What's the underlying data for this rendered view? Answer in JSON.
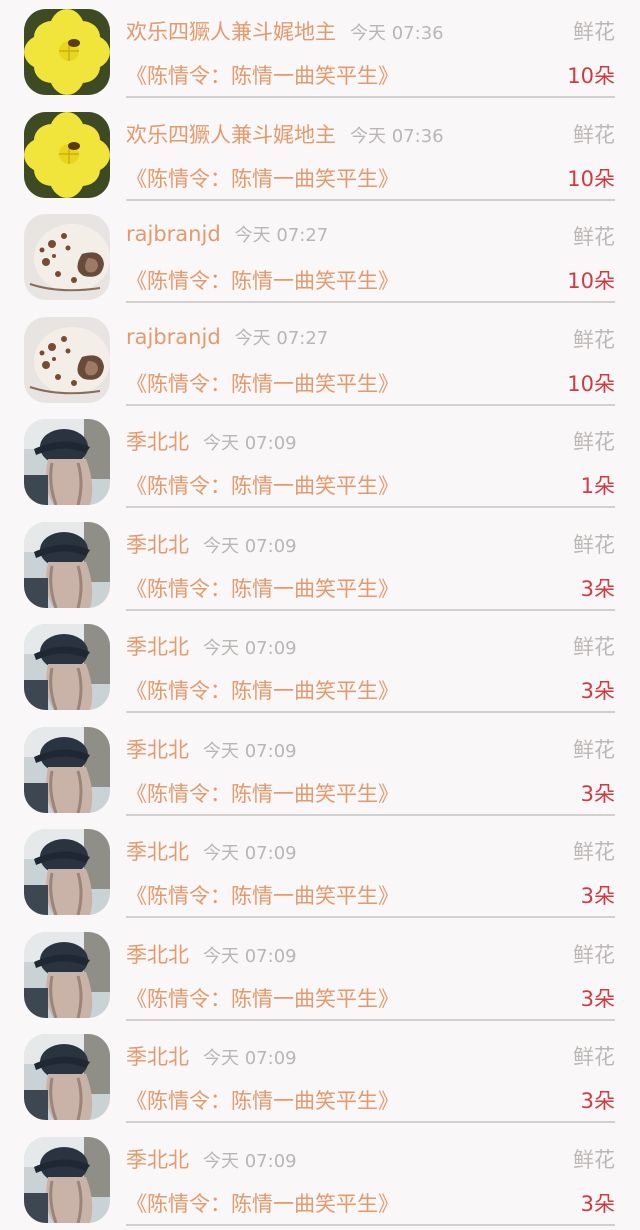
{
  "gifts": [
    {
      "avatar": "yellow-flower-avatar",
      "user": "欢乐四獗人兼斗娓地主",
      "time": "今天 07:36",
      "gift": "鲜花",
      "work": "《陈情令：陈情一曲笑平生》",
      "count": "10朵"
    },
    {
      "avatar": "yellow-flower-avatar",
      "user": "欢乐四獗人兼斗娓地主",
      "time": "今天 07:36",
      "gift": "鲜花",
      "work": "《陈情令：陈情一曲笑平生》",
      "count": "10朵"
    },
    {
      "avatar": "seashell-avatar",
      "user": "rajbranjd",
      "time": "今天 07:27",
      "gift": "鲜花",
      "work": "《陈情令：陈情一曲笑平生》",
      "count": "10朵"
    },
    {
      "avatar": "seashell-avatar",
      "user": "rajbranjd",
      "time": "今天 07:27",
      "gift": "鲜花",
      "work": "《陈情令：陈情一曲笑平生》",
      "count": "10朵"
    },
    {
      "avatar": "girl-cap-avatar",
      "user": "季北北",
      "time": "今天 07:09",
      "gift": "鲜花",
      "work": "《陈情令：陈情一曲笑平生》",
      "count": "1朵"
    },
    {
      "avatar": "girl-cap-avatar",
      "user": "季北北",
      "time": "今天 07:09",
      "gift": "鲜花",
      "work": "《陈情令：陈情一曲笑平生》",
      "count": "3朵"
    },
    {
      "avatar": "girl-cap-avatar",
      "user": "季北北",
      "time": "今天 07:09",
      "gift": "鲜花",
      "work": "《陈情令：陈情一曲笑平生》",
      "count": "3朵"
    },
    {
      "avatar": "girl-cap-avatar",
      "user": "季北北",
      "time": "今天 07:09",
      "gift": "鲜花",
      "work": "《陈情令：陈情一曲笑平生》",
      "count": "3朵"
    },
    {
      "avatar": "girl-cap-avatar",
      "user": "季北北",
      "time": "今天 07:09",
      "gift": "鲜花",
      "work": "《陈情令：陈情一曲笑平生》",
      "count": "3朵"
    },
    {
      "avatar": "girl-cap-avatar",
      "user": "季北北",
      "time": "今天 07:09",
      "gift": "鲜花",
      "work": "《陈情令：陈情一曲笑平生》",
      "count": "3朵"
    },
    {
      "avatar": "girl-cap-avatar",
      "user": "季北北",
      "time": "今天 07:09",
      "gift": "鲜花",
      "work": "《陈情令：陈情一曲笑平生》",
      "count": "3朵"
    },
    {
      "avatar": "girl-cap-avatar",
      "user": "季北北",
      "time": "今天 07:09",
      "gift": "鲜花",
      "work": "《陈情令：陈情一曲笑平生》",
      "count": "3朵"
    }
  ]
}
